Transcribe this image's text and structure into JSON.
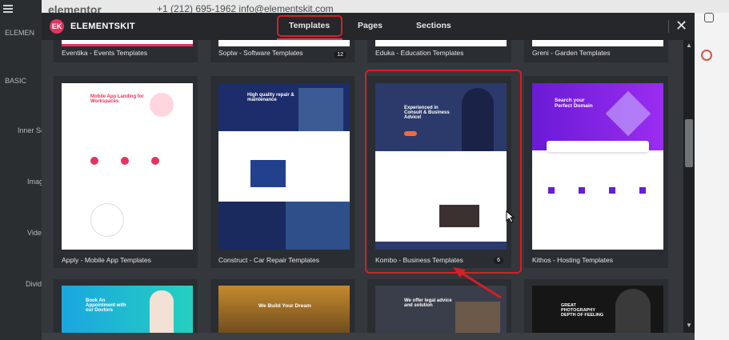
{
  "background": {
    "brand": "elementor",
    "contact": "+1 (212) 695-1962   info@elementskit.com",
    "panel_items": [
      "ELEMEN",
      "BASIC",
      "Inner Se",
      "Imag",
      "Vide",
      "Divid"
    ]
  },
  "modal": {
    "logo": "EK",
    "brand": "ELEMENTSKIT",
    "tabs": [
      {
        "label": "Templates",
        "active": true
      },
      {
        "label": "Pages",
        "active": false
      },
      {
        "label": "Sections",
        "active": false
      }
    ],
    "close_symbol": "✕"
  },
  "templates_row1": [
    {
      "title": "Eventika - Events Templates",
      "count": ""
    },
    {
      "title": "Soptw - Software Templates",
      "count": "12"
    },
    {
      "title": "Eduka - Education Templates",
      "count": ""
    },
    {
      "title": "Greni - Garden Templates",
      "count": ""
    }
  ],
  "templates_row2": [
    {
      "title": "Apply - Mobile App Templates",
      "count": ""
    },
    {
      "title": "Construct - Car Repair Templates",
      "count": ""
    },
    {
      "title": "Kombo - Business Templates",
      "count": "6"
    },
    {
      "title": "Kithos - Hosting Templates",
      "count": ""
    }
  ],
  "previews": {
    "apply": "Mobile App Landing for Workspaces",
    "construct": "High quality repair & maintenance",
    "kombo": "Experienced in Consult & Business Advice!",
    "kithos": "Search your Perfect Domain",
    "row3a": "Book An Appointment with our Doctors",
    "row3b": "We Build Your Dream",
    "row3c": "We offer legal advice and solution",
    "row3d": "GREAT PHOTOGRAPHY DEPTH OF FEELING"
  },
  "colors": {
    "accent": "#e7325f",
    "highlight": "#d61f26"
  }
}
